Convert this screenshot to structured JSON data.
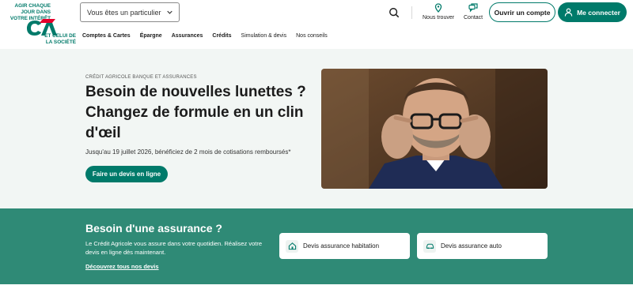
{
  "brand": {
    "tagline": "AGIR CHAQUE JOUR DANS VOTRE INTÉRÊT",
    "subline": "ET CELUI DE LA SOCIÉTÉ",
    "logo_letters": "CA",
    "colors": {
      "primary": "#007a6a",
      "accent_red": "#e4002b",
      "band": "#2f8a76"
    }
  },
  "header": {
    "profile_select": {
      "value": "Vous êtes un particulier"
    },
    "search_icon": "search-icon",
    "tools": [
      {
        "label": "Nous trouver",
        "icon": "map-pin-icon"
      },
      {
        "label": "Contact",
        "icon": "chat-icon"
      }
    ],
    "open_account_label": "Ouvrir un compte",
    "login_label": "Me connecter"
  },
  "menu": [
    {
      "label": "Comptes & Cartes",
      "bold": true
    },
    {
      "label": "Épargne",
      "bold": true
    },
    {
      "label": "Assurances",
      "bold": true
    },
    {
      "label": "Crédits",
      "bold": true
    },
    {
      "label": "Simulation & devis",
      "bold": false
    },
    {
      "label": "Nos conseils",
      "bold": false
    }
  ],
  "hero": {
    "eyebrow": "CRÉDIT AGRICOLE BANQUE ET ASSURANCES",
    "title": "Besoin de nouvelles lunettes ? Changez de formule en un clin d'œil",
    "description": "Jusqu'au 19 juillet 2026, bénéficiez de 2 mois de cotisations remboursés*",
    "cta_label": "Faire un devis en ligne"
  },
  "insurance": {
    "title": "Besoin d'une assurance ?",
    "text": "Le Crédit Agricole vous assure dans votre quotidien. Réalisez votre devis en ligne dès maintenant.",
    "link_label": "Découvrez tous nos devis",
    "cards": [
      {
        "label": "Devis assurance habitation",
        "icon": "house-icon"
      },
      {
        "label": "Devis assurance auto",
        "icon": "car-icon"
      }
    ]
  }
}
